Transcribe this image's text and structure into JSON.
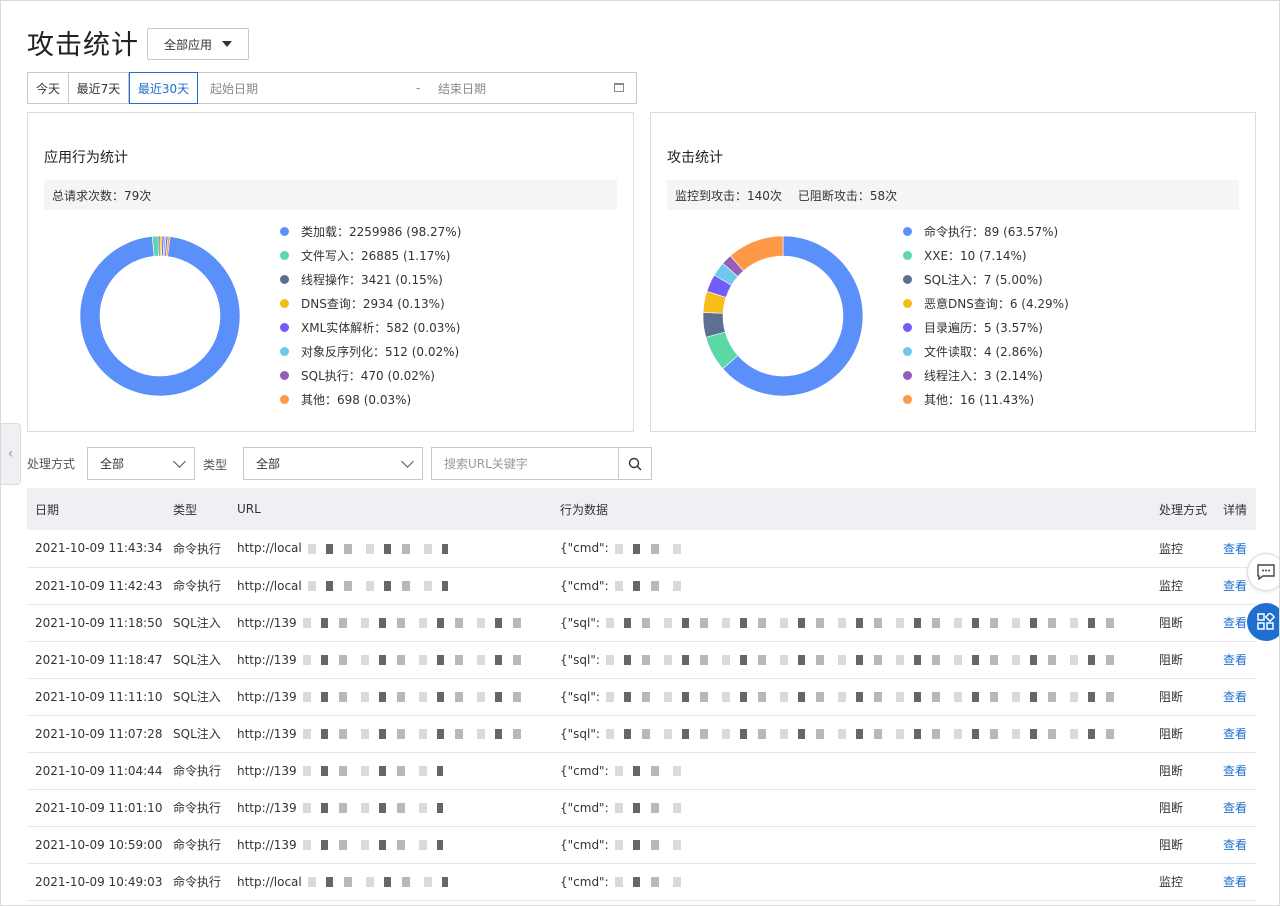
{
  "page": {
    "title": "攻击统计",
    "app_select": "全部应用"
  },
  "date_range": {
    "today": "今天",
    "last7": "最近7天",
    "last30": "最近30天",
    "start_placeholder": "起始日期",
    "sep": "-",
    "end_placeholder": "结束日期"
  },
  "behavior_card": {
    "title": "应用行为统计",
    "summary": "总请求次数：79次",
    "legend": [
      {
        "label": "类加载：2259986 (98.27%)",
        "color": "#5b8ff9",
        "value": 98.27
      },
      {
        "label": "文件写入：26885 (1.17%)",
        "color": "#5ad8a6",
        "value": 1.17
      },
      {
        "label": "线程操作：3421 (0.15%)",
        "color": "#5d7092",
        "value": 0.15
      },
      {
        "label": "DNS查询：2934 (0.13%)",
        "color": "#f6bd16",
        "value": 0.13
      },
      {
        "label": "XML实体解析：582 (0.03%)",
        "color": "#6f5ef9",
        "value": 0.03
      },
      {
        "label": "对象反序列化：512 (0.02%)",
        "color": "#6dc8ec",
        "value": 0.02
      },
      {
        "label": "SQL执行：470 (0.02%)",
        "color": "#945fb9",
        "value": 0.02
      },
      {
        "label": "其他：698 (0.03%)",
        "color": "#ff9845",
        "value": 0.03
      }
    ]
  },
  "attack_card": {
    "title": "攻击统计",
    "summary_monitor": "监控到攻击：140次",
    "summary_block": "已阻断攻击：58次",
    "legend": [
      {
        "label": "命令执行：89 (63.57%)",
        "color": "#5b8ff9",
        "value": 63.57
      },
      {
        "label": "XXE：10 (7.14%)",
        "color": "#5ad8a6",
        "value": 7.14
      },
      {
        "label": "SQL注入：7 (5.00%)",
        "color": "#5d7092",
        "value": 5.0
      },
      {
        "label": "恶意DNS查询：6 (4.29%)",
        "color": "#f6bd16",
        "value": 4.29
      },
      {
        "label": "目录遍历：5 (3.57%)",
        "color": "#6f5ef9",
        "value": 3.57
      },
      {
        "label": "文件读取：4 (2.86%)",
        "color": "#6dc8ec",
        "value": 2.86
      },
      {
        "label": "线程注入：3 (2.14%)",
        "color": "#945fb9",
        "value": 2.14
      },
      {
        "label": "其他：16 (11.43%)",
        "color": "#ff9845",
        "value": 11.43
      }
    ]
  },
  "filters": {
    "method_label": "处理方式",
    "method_value": "全部",
    "type_label": "类型",
    "type_value": "全部",
    "search_placeholder": "搜索URL关键字"
  },
  "table": {
    "headers": [
      "日期",
      "类型",
      "URL",
      "行为数据",
      "处理方式",
      "详情"
    ],
    "rows": [
      {
        "date": "2021-10-09 11:43:34",
        "type": "命令执行",
        "url": "http://local",
        "data": "{\"cmd\":",
        "action": "监控",
        "detail": "查看"
      },
      {
        "date": "2021-10-09 11:42:43",
        "type": "命令执行",
        "url": "http://local",
        "data": "{\"cmd\":",
        "action": "监控",
        "detail": "查看"
      },
      {
        "date": "2021-10-09 11:18:50",
        "type": "SQL注入",
        "url": "http://139",
        "data": "{\"sql\":",
        "action": "阻断",
        "detail": "查看"
      },
      {
        "date": "2021-10-09 11:18:47",
        "type": "SQL注入",
        "url": "http://139",
        "data": "{\"sql\":",
        "action": "阻断",
        "detail": "查看"
      },
      {
        "date": "2021-10-09 11:11:10",
        "type": "SQL注入",
        "url": "http://139",
        "data": "{\"sql\":",
        "action": "阻断",
        "detail": "查看"
      },
      {
        "date": "2021-10-09 11:07:28",
        "type": "SQL注入",
        "url": "http://139",
        "data": "{\"sql\":",
        "action": "阻断",
        "detail": "查看"
      },
      {
        "date": "2021-10-09 11:04:44",
        "type": "命令执行",
        "url": "http://139",
        "data": "{\"cmd\":",
        "action": "阻断",
        "detail": "查看"
      },
      {
        "date": "2021-10-09 11:01:10",
        "type": "命令执行",
        "url": "http://139",
        "data": "{\"cmd\":",
        "action": "阻断",
        "detail": "查看"
      },
      {
        "date": "2021-10-09 10:59:00",
        "type": "命令执行",
        "url": "http://139",
        "data": "{\"cmd\":",
        "action": "阻断",
        "detail": "查看"
      },
      {
        "date": "2021-10-09 10:49:03",
        "type": "命令执行",
        "url": "http://local",
        "data": "{\"cmd\":",
        "action": "监控",
        "detail": "查看"
      }
    ]
  }
}
